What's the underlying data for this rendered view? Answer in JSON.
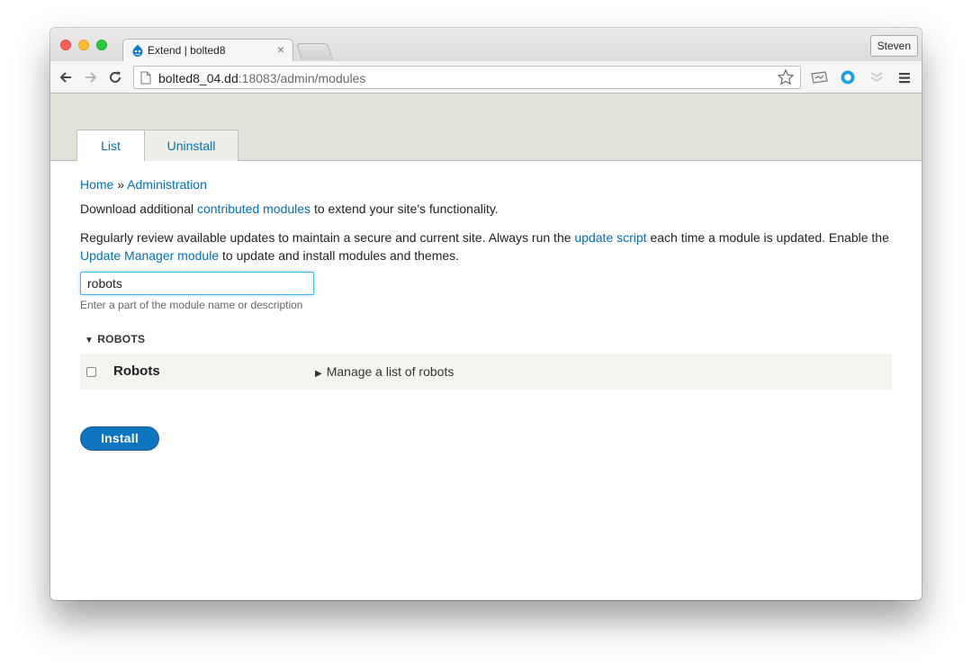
{
  "browser": {
    "tab_title": "Extend | bolted8",
    "tab_close": "×",
    "profile_name": "Steven",
    "url_host": "bolted8_04.dd",
    "url_rest": ":18083/admin/modules"
  },
  "page_tabs": {
    "list": "List",
    "uninstall": "Uninstall"
  },
  "breadcrumb": {
    "home": "Home",
    "separator": "»",
    "administration": "Administration"
  },
  "intro": {
    "download_prefix": "Download additional",
    "contributed_link": "contributed modules",
    "download_suffix": "to extend your site's functionality.",
    "updates_prefix": "Regularly review available updates to maintain a secure and current site. Always run the",
    "update_script_link": "update script",
    "updates_middle": "each time a module is updated. Enable the",
    "update_manager_link": "Update Manager module",
    "updates_suffix": "to update and install modules and themes."
  },
  "filter": {
    "value": "robots",
    "description": "Enter a part of the module name or description"
  },
  "package": {
    "toggle_icon": "▼",
    "name": "ROBOTS"
  },
  "module": {
    "name": "Robots",
    "desc_icon": "▶",
    "description": "Manage a list of robots",
    "checked": false
  },
  "install_label": "Install",
  "colors": {
    "link": "#0071b8",
    "button": "#0f74bf",
    "admin_header": "#e1e1da",
    "row_bg": "#f3f4ee"
  }
}
